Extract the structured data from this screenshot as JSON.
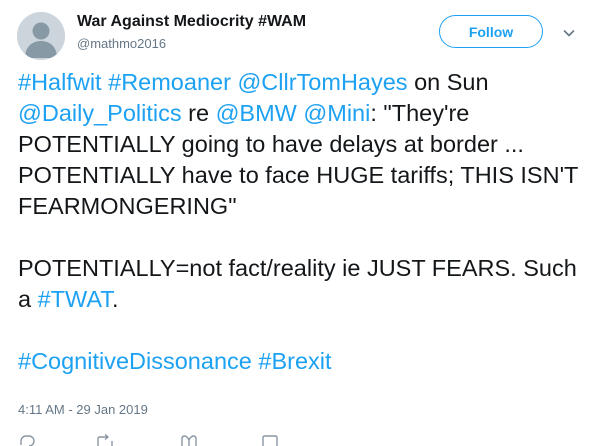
{
  "author": {
    "display_name": "War Against Mediocrity #WAM",
    "handle": "@mathmo2016",
    "avatar_icon": "default-avatar-icon"
  },
  "header": {
    "follow_label": "Follow",
    "menu_icon": "chevron-down-icon"
  },
  "tweet": {
    "p1": {
      "t1": "#Halfwit",
      "t2": " ",
      "t3": "#Remoaner",
      "t4": " ",
      "t5": "@CllrTomHayes",
      "t6": " on Sun ",
      "t7": "@Daily_Politics",
      "t8": " re ",
      "t9": "@BMW",
      "t10": " ",
      "t11": "@Mini",
      "t12": ": \"They're POTENTIALLY going to have delays at border ... POTENTIALLY have to face HUGE tariffs; THIS ISN'T FEARMONGERING\""
    },
    "p2": {
      "t1": "POTENTIALLY=not fact/reality ie JUST FEARS. Such a ",
      "t2": "#TWAT",
      "t3": "."
    },
    "p3": {
      "t1": "#CognitiveDissonance",
      "t2": " ",
      "t3": "#Brexit"
    },
    "timestamp": "4:11 AM - 29 Jan 2019"
  },
  "colors": {
    "link": "#1da1f2",
    "text": "#14171a",
    "secondary": "#657786"
  }
}
